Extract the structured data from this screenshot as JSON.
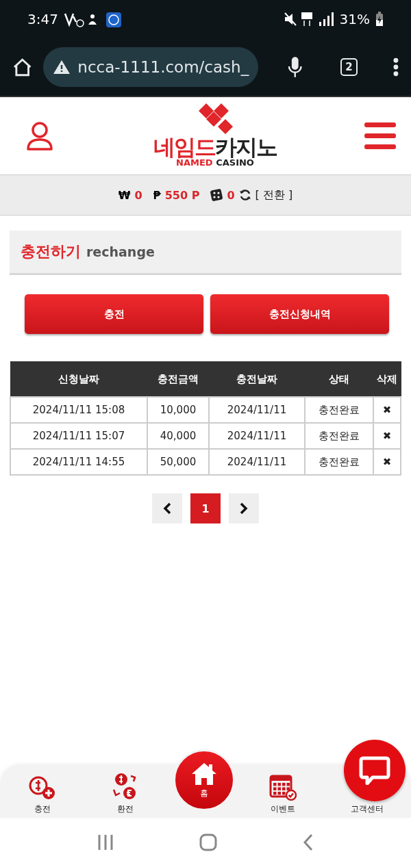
{
  "status_bar": {
    "time": "3:47",
    "battery": "31%"
  },
  "browser": {
    "url": "ncca-1111.com/cash_",
    "tab_count": "2"
  },
  "logo": {
    "korean_red": "네임드",
    "korean_dark": "카지노",
    "english_red": "NAMED",
    "english_dark": "CASINO"
  },
  "balance": {
    "won_symbol": "₩",
    "won": "0",
    "point_symbol": "₱",
    "points": "550 P",
    "chips": "0",
    "convert": "[ 전환 ]"
  },
  "section": {
    "title": "충전하기",
    "subtitle": "rechange"
  },
  "buttons": [
    {
      "label": "충전"
    },
    {
      "label": "충전신청내역"
    }
  ],
  "table": {
    "columns": [
      "신청날짜",
      "충전금액",
      "충전날짜",
      "상태",
      "삭제"
    ],
    "rows": [
      {
        "requested": "2024/11/11 15:08",
        "amount": "10,000",
        "charged": "2024/11/11",
        "status": "충전완료",
        "delete": "✖"
      },
      {
        "requested": "2024/11/11 15:07",
        "amount": "40,000",
        "charged": "2024/11/11",
        "status": "충전완료",
        "delete": "✖"
      },
      {
        "requested": "2024/11/11 14:55",
        "amount": "50,000",
        "charged": "2024/11/11",
        "status": "충전완료",
        "delete": "✖"
      }
    ]
  },
  "pagination": {
    "pages": [
      {
        "label": "1",
        "selected": true
      }
    ]
  },
  "bottom_nav": [
    {
      "label": "충전",
      "kind": "plain"
    },
    {
      "label": "환전",
      "kind": "plain"
    },
    {
      "label": "홈",
      "kind": "center"
    },
    {
      "label": "이벤트",
      "kind": "plain"
    },
    {
      "label": "고객센터",
      "kind": "plain"
    }
  ]
}
